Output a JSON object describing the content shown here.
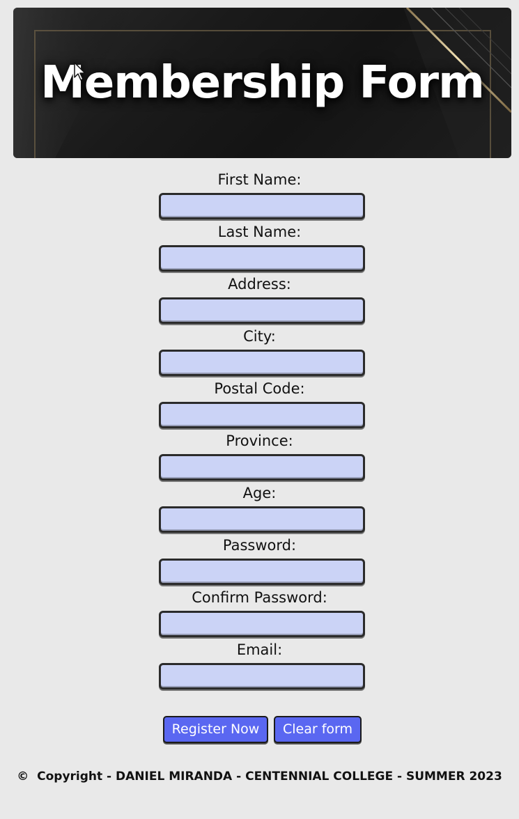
{
  "banner": {
    "title": "Membership Form"
  },
  "form": {
    "fields": [
      {
        "label": "First Name:",
        "value": ""
      },
      {
        "label": "Last Name:",
        "value": ""
      },
      {
        "label": "Address:",
        "value": ""
      },
      {
        "label": "City:",
        "value": ""
      },
      {
        "label": "Postal Code:",
        "value": ""
      },
      {
        "label": "Province:",
        "value": ""
      },
      {
        "label": "Age:",
        "value": ""
      },
      {
        "label": "Password:",
        "value": ""
      },
      {
        "label": "Confirm Password:",
        "value": ""
      },
      {
        "label": "Email:",
        "value": ""
      }
    ],
    "register_label": "Register Now",
    "clear_label": "Clear form"
  },
  "footer": {
    "symbol": "©",
    "text": "Copyright - DANIEL MIRANDA - CENTENNIAL COLLEGE - SUMMER 2023"
  },
  "colors": {
    "page_background": "#e9e9e9",
    "input_background": "#cbd3f6",
    "button_background": "#5a67f1",
    "banner_background": "#1a1a1a"
  },
  "icons": {
    "cursor": "arrow-cursor-icon"
  }
}
